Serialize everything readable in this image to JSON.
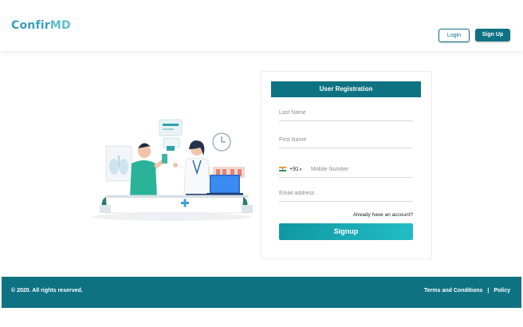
{
  "header": {
    "logo_part1": "Confir",
    "logo_part2": "MD",
    "login_label": "Login",
    "signup_label": "Sign Up"
  },
  "form": {
    "title": "User Registration",
    "last_name_placeholder": "Last Name",
    "first_name_placeholder": "First Name",
    "country_code": "+91",
    "mobile_placeholder": "Mobile Number",
    "email_placeholder": "Email address",
    "account_link": "Already have an account?",
    "submit_label": "Signup"
  },
  "footer": {
    "copyright": "© 2020. All rights reserved.",
    "terms": "Terms and Conditions",
    "separator": "|",
    "policy": "Policy"
  },
  "colors": {
    "primary": "#0f7283",
    "accent": "#23bcc5",
    "logo": "#3b9fb3"
  }
}
